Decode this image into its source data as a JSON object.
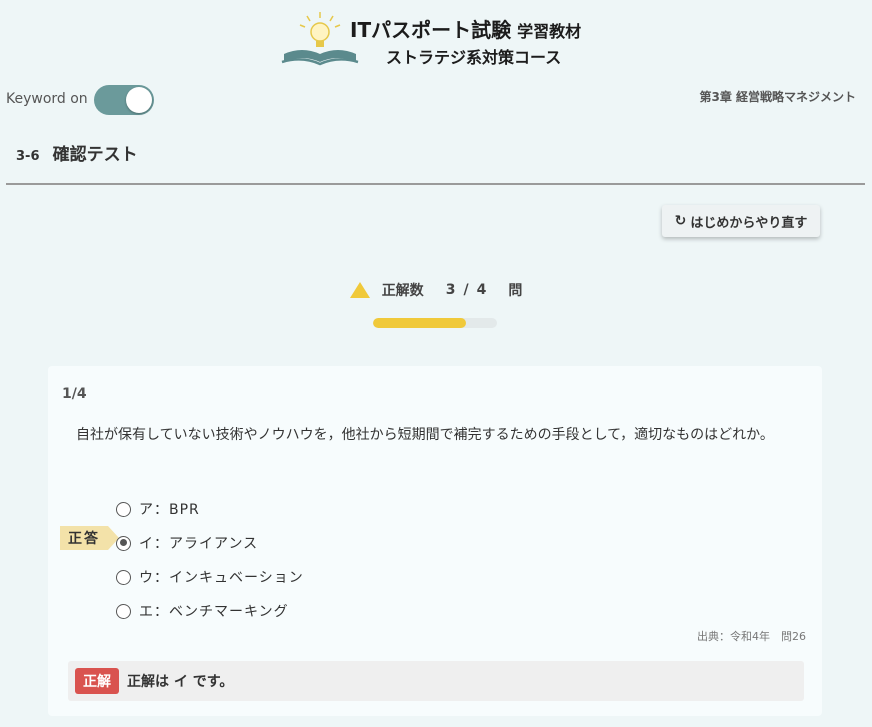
{
  "header": {
    "title": "ITパスポート試験",
    "title_sub": "学習教材",
    "course": "ストラテジ系対策コース"
  },
  "keyword": {
    "label": "Keyword on",
    "on": true
  },
  "chapter": "第3章 経営戦略マネジメント",
  "section": {
    "number": "3-6",
    "name": "確認テスト"
  },
  "restart_label": "はじめからやり直す",
  "score": {
    "label": "正解数",
    "correct": "3",
    "separator": "/",
    "total": "4",
    "unit": "問",
    "progress_fraction": 0.75
  },
  "question": {
    "number": "1/4",
    "text": "自社が保有していない技術やノウハウを，他社から短期間で補完するための手段として，適切なものはどれか。",
    "options": [
      {
        "label": "ア：BPR",
        "checked": false
      },
      {
        "label": "イ：アライアンス",
        "checked": true
      },
      {
        "label": "ウ：インキュベーション",
        "checked": false
      },
      {
        "label": "エ：ベンチマーキング",
        "checked": false
      }
    ],
    "correct_badge": "正答",
    "source": "出典：令和4年　問26"
  },
  "result": {
    "tag": "正解",
    "message": "正解は イ です。"
  },
  "colors": {
    "accent": "#f0c93a",
    "toggle": "#6b9a9b",
    "badge_red": "#d9534f",
    "badge_answer": "#f3e2a9"
  },
  "icons": {
    "logo": "lightbulb-book-icon",
    "restart": "refresh-icon",
    "score": "triangle-icon"
  }
}
